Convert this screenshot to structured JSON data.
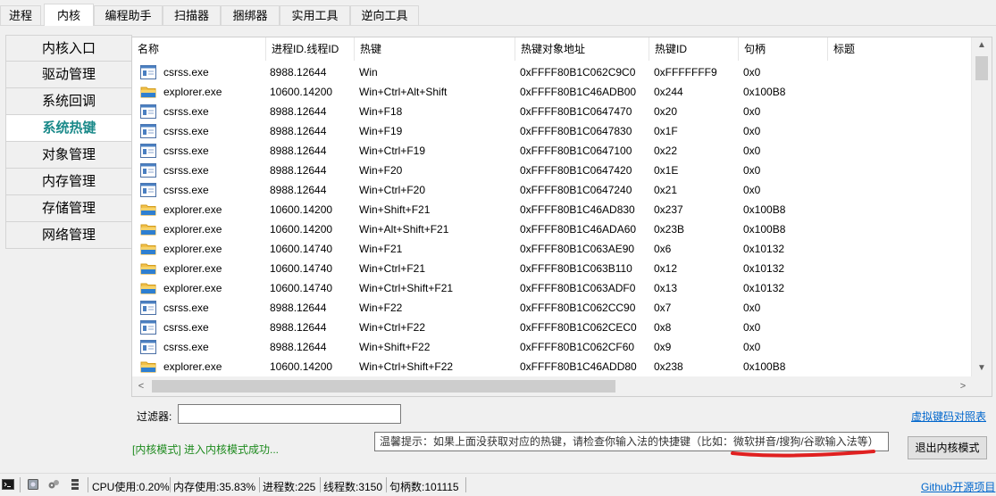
{
  "tabs": [
    "进程",
    "内核",
    "编程助手",
    "扫描器",
    "捆绑器",
    "实用工具",
    "逆向工具"
  ],
  "nav": [
    "内核入口",
    "驱动管理",
    "系统回调",
    "系统热键",
    "对象管理",
    "内存管理",
    "存储管理",
    "网络管理"
  ],
  "columns": [
    "名称",
    "进程ID.线程ID",
    "热键",
    "热键对象地址",
    "热键ID",
    "句柄",
    "标题"
  ],
  "rows": [
    {
      "icon": "csrss-app-icon",
      "name": "csrss.exe",
      "pid": "8988.12644",
      "hotkey": "Win",
      "addr": "0xFFFF80B1C062C9C0",
      "id": "0xFFFFFFF9",
      "handle": "0x0",
      "title": ""
    },
    {
      "icon": "explorer-folder-icon",
      "name": "explorer.exe",
      "pid": "10600.14200",
      "hotkey": "Win+Ctrl+Alt+Shift",
      "addr": "0xFFFF80B1C46ADB00",
      "id": "0x244",
      "handle": "0x100B8",
      "title": ""
    },
    {
      "icon": "csrss-app-icon",
      "name": "csrss.exe",
      "pid": "8988.12644",
      "hotkey": "Win+F18",
      "addr": "0xFFFF80B1C0647470",
      "id": "0x20",
      "handle": "0x0",
      "title": ""
    },
    {
      "icon": "csrss-app-icon",
      "name": "csrss.exe",
      "pid": "8988.12644",
      "hotkey": "Win+F19",
      "addr": "0xFFFF80B1C0647830",
      "id": "0x1F",
      "handle": "0x0",
      "title": ""
    },
    {
      "icon": "csrss-app-icon",
      "name": "csrss.exe",
      "pid": "8988.12644",
      "hotkey": "Win+Ctrl+F19",
      "addr": "0xFFFF80B1C0647100",
      "id": "0x22",
      "handle": "0x0",
      "title": ""
    },
    {
      "icon": "csrss-app-icon",
      "name": "csrss.exe",
      "pid": "8988.12644",
      "hotkey": "Win+F20",
      "addr": "0xFFFF80B1C0647420",
      "id": "0x1E",
      "handle": "0x0",
      "title": ""
    },
    {
      "icon": "csrss-app-icon",
      "name": "csrss.exe",
      "pid": "8988.12644",
      "hotkey": "Win+Ctrl+F20",
      "addr": "0xFFFF80B1C0647240",
      "id": "0x21",
      "handle": "0x0",
      "title": ""
    },
    {
      "icon": "explorer-folder-icon",
      "name": "explorer.exe",
      "pid": "10600.14200",
      "hotkey": "Win+Shift+F21",
      "addr": "0xFFFF80B1C46AD830",
      "id": "0x237",
      "handle": "0x100B8",
      "title": ""
    },
    {
      "icon": "explorer-folder-icon",
      "name": "explorer.exe",
      "pid": "10600.14200",
      "hotkey": "Win+Alt+Shift+F21",
      "addr": "0xFFFF80B1C46ADA60",
      "id": "0x23B",
      "handle": "0x100B8",
      "title": ""
    },
    {
      "icon": "explorer-folder-icon",
      "name": "explorer.exe",
      "pid": "10600.14740",
      "hotkey": "Win+F21",
      "addr": "0xFFFF80B1C063AE90",
      "id": "0x6",
      "handle": "0x10132",
      "title": ""
    },
    {
      "icon": "explorer-folder-icon",
      "name": "explorer.exe",
      "pid": "10600.14740",
      "hotkey": "Win+Ctrl+F21",
      "addr": "0xFFFF80B1C063B110",
      "id": "0x12",
      "handle": "0x10132",
      "title": ""
    },
    {
      "icon": "explorer-folder-icon",
      "name": "explorer.exe",
      "pid": "10600.14740",
      "hotkey": "Win+Ctrl+Shift+F21",
      "addr": "0xFFFF80B1C063ADF0",
      "id": "0x13",
      "handle": "0x10132",
      "title": ""
    },
    {
      "icon": "csrss-app-icon",
      "name": "csrss.exe",
      "pid": "8988.12644",
      "hotkey": "Win+F22",
      "addr": "0xFFFF80B1C062CC90",
      "id": "0x7",
      "handle": "0x0",
      "title": ""
    },
    {
      "icon": "csrss-app-icon",
      "name": "csrss.exe",
      "pid": "8988.12644",
      "hotkey": "Win+Ctrl+F22",
      "addr": "0xFFFF80B1C062CEC0",
      "id": "0x8",
      "handle": "0x0",
      "title": ""
    },
    {
      "icon": "csrss-app-icon",
      "name": "csrss.exe",
      "pid": "8988.12644",
      "hotkey": "Win+Shift+F22",
      "addr": "0xFFFF80B1C062CF60",
      "id": "0x9",
      "handle": "0x0",
      "title": ""
    },
    {
      "icon": "explorer-folder-icon",
      "name": "explorer.exe",
      "pid": "10600.14200",
      "hotkey": "Win+Ctrl+Shift+F22",
      "addr": "0xFFFF80B1C46ADD80",
      "id": "0x238",
      "handle": "0x100B8",
      "title": ""
    }
  ],
  "filter": {
    "label": "过滤器:",
    "value": ""
  },
  "vk_link": "虚拟键码对照表",
  "status_message": "[内核模式] 进入内核模式成功...",
  "tip": "温馨提示：如果上面没获取对应的热键，请检查你输入法的快捷键（比如：微软拼音/搜狗/谷歌输入法等）",
  "exit_button": "退出内核模式",
  "statusbar": {
    "cpu": "CPU使用:0.20%",
    "mem": "内存使用:35.83%",
    "procs": "进程数:225",
    "threads": "线程数:3150",
    "handles": "句柄数:101115",
    "github": "Github开源项目"
  },
  "colors": {
    "accent_teal": "#1b8a8a",
    "success_green": "#1e8a1e",
    "link_blue": "#0066cc",
    "underline_red": "#e02020"
  }
}
